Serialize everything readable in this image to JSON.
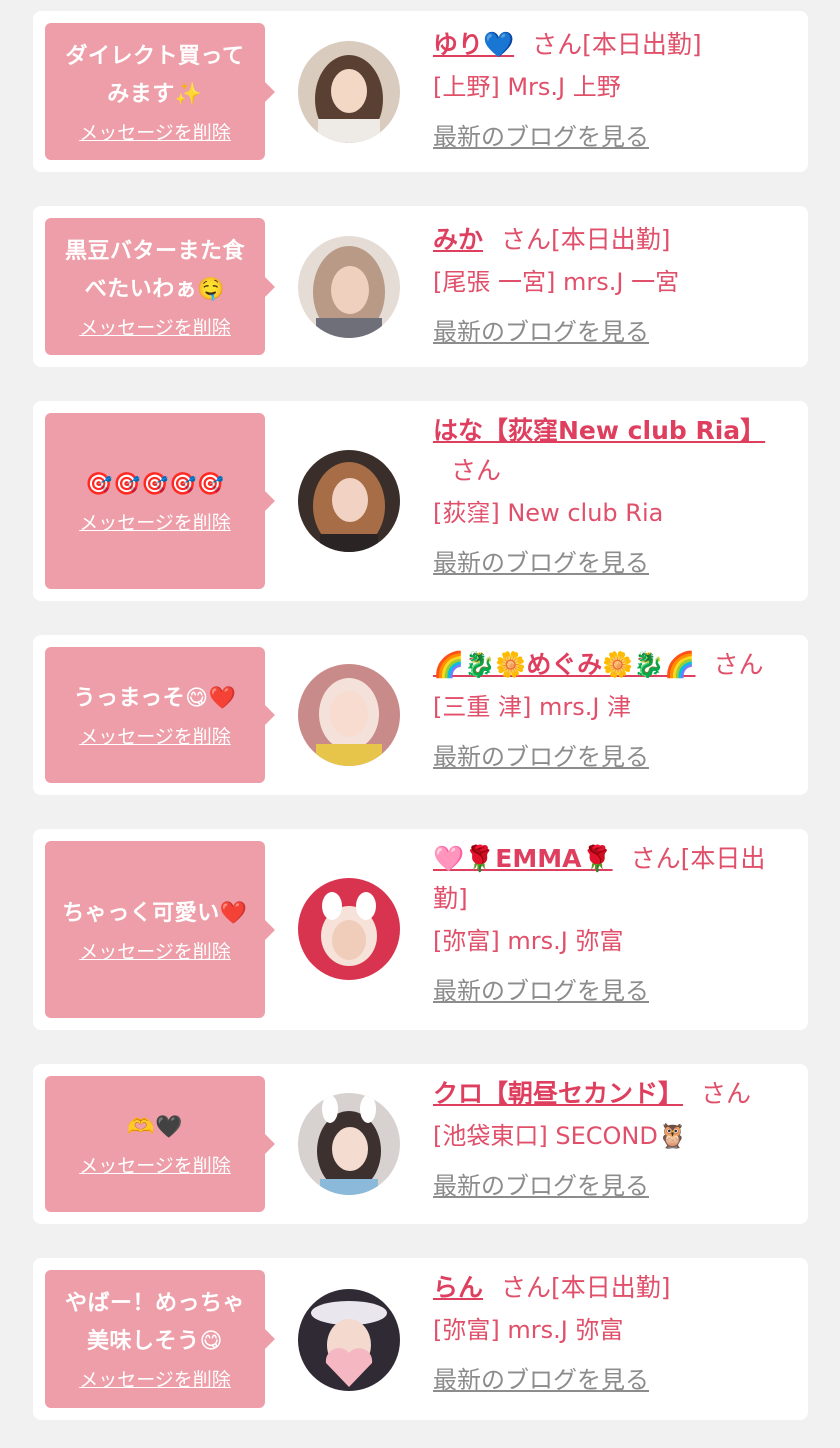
{
  "delete_label": "メッセージを削除",
  "blog_label": "最新のブログを見る",
  "colors": {
    "bubble": "#ee9ea8",
    "name": "#df3f5f",
    "text": "#e0506a",
    "link_gray": "#8c8c8c",
    "background": "#f1f1f1"
  },
  "items": [
    {
      "message_lines": [
        "ダイレクト買って",
        "みます✨"
      ],
      "name": "ゆり💙",
      "suffix": "さん[本日出勤]",
      "shop": "[上野] Mrs.J 上野"
    },
    {
      "message_lines": [
        "黒豆バターまた食",
        "べたいわぁ🤤"
      ],
      "name": "みか",
      "suffix": "さん[本日出勤]",
      "shop": "[尾張 一宮] mrs.J 一宮"
    },
    {
      "message_lines": [
        "🎯🎯🎯🎯🎯"
      ],
      "name": "はな【荻窪New club Ria】",
      "suffix": "さん",
      "shop": "[荻窪] New club Ria"
    },
    {
      "message_lines": [
        "うっまっそ😋❤️"
      ],
      "name": "🌈🐉🌼めぐみ🌼🐉🌈",
      "suffix": "さん",
      "shop": "[三重 津] mrs.J 津"
    },
    {
      "message_lines": [
        "ちゃっく可愛い❤️"
      ],
      "name": "🩷🌹EMMA🌹",
      "suffix": "さん[本日出勤]",
      "shop": "[弥富] mrs.J 弥富"
    },
    {
      "message_lines": [
        "🫶🖤"
      ],
      "name": "クロ【朝昼セカンド】",
      "suffix": "さん",
      "shop": "[池袋東口] SECOND🦉"
    },
    {
      "message_lines": [
        "やばー！めっちゃ",
        "美味しそう😋"
      ],
      "name": "らん",
      "suffix": "さん[本日出勤]",
      "shop": "[弥富] mrs.J 弥富"
    }
  ]
}
